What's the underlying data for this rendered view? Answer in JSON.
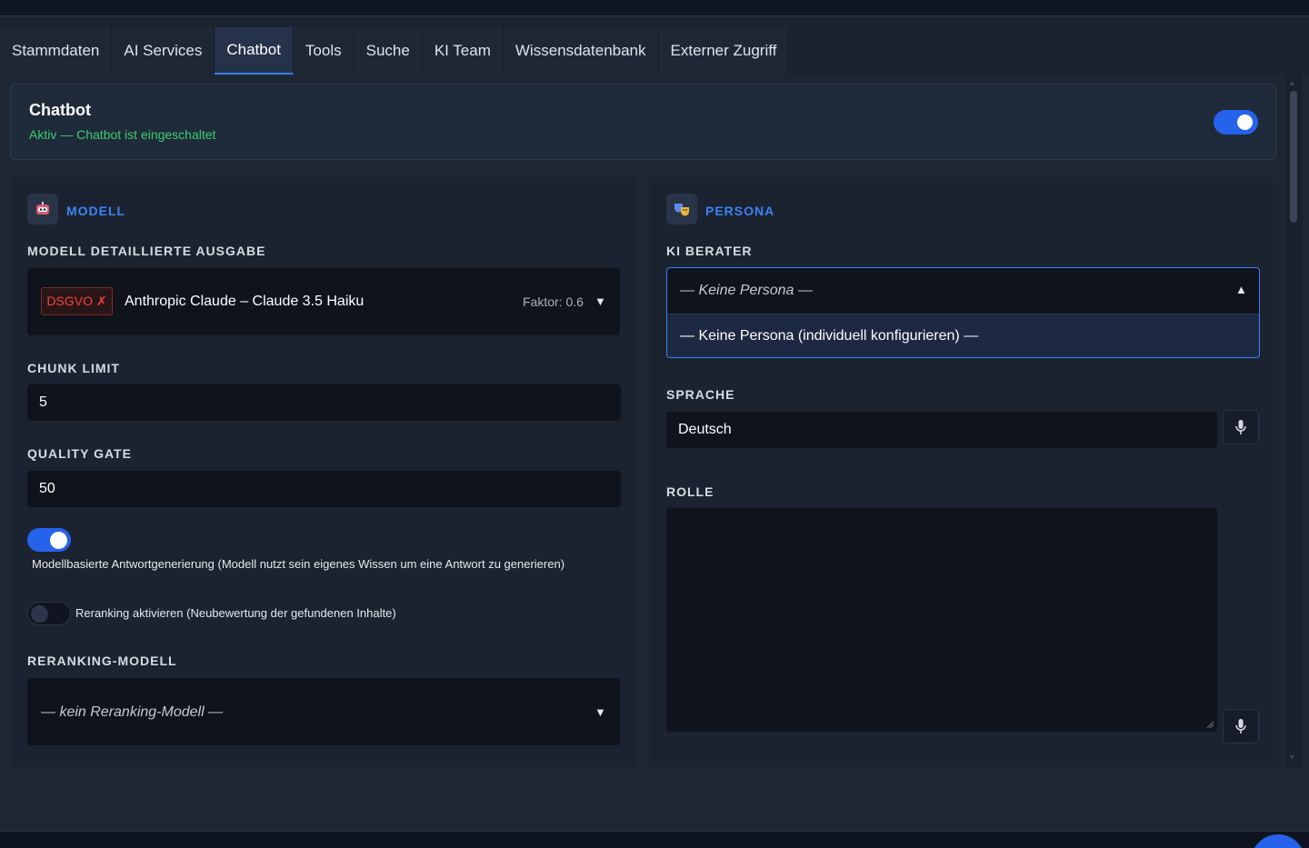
{
  "tabs": [
    {
      "label": "Stammdaten",
      "active": false
    },
    {
      "label": "AI Services",
      "active": false
    },
    {
      "label": "Chatbot",
      "active": true
    },
    {
      "label": "Tools",
      "active": false
    },
    {
      "label": "Suche",
      "active": false
    },
    {
      "label": "KI Team",
      "active": false
    },
    {
      "label": "Wissensdatenbank",
      "active": false
    },
    {
      "label": "Externer Zugriff",
      "active": false
    }
  ],
  "status": {
    "title": "Chatbot",
    "subtitle": "Aktiv — Chatbot ist eingeschaltet",
    "enabled": true
  },
  "model": {
    "section_title": "MODELL",
    "detail_label": "MODELL DETAILLIERTE AUSGABE",
    "badge": "DSGVO ✗",
    "selected_model": "Anthropic Claude – Claude 3.5 Haiku",
    "factor": "Faktor: 0.6",
    "chunk_label": "CHUNK LIMIT",
    "chunk_value": "5",
    "quality_label": "QUALITY GATE",
    "quality_value": "50",
    "model_based_toggle": {
      "enabled": true,
      "label": "Modellbasierte Antwortgenerierung (Modell nutzt sein eigenes Wissen um eine Antwort zu generieren)"
    },
    "reranking_toggle": {
      "enabled": false,
      "label": "Reranking aktivieren (Neubewertung der gefundenen Inhalte)"
    },
    "reranking_label": "RERANKING-MODELL",
    "reranking_value": "— kein Reranking-Modell —"
  },
  "persona": {
    "section_title": "PERSONA",
    "advisor_label": "KI BERATER",
    "advisor_value": "— Keine Persona —",
    "dropdown_options": [
      "— Keine Persona (individuell konfigurieren) —"
    ],
    "language_label": "SPRACHE",
    "language_value": "Deutsch",
    "role_label": "ROLLE",
    "role_value": ""
  },
  "colors": {
    "accent": "#3b82f6",
    "active_green": "#3ccf6e",
    "danger": "#ef4444"
  },
  "icons": {
    "model": "robot-icon",
    "persona": "theater-masks-icon",
    "mic": "microphone-icon"
  }
}
